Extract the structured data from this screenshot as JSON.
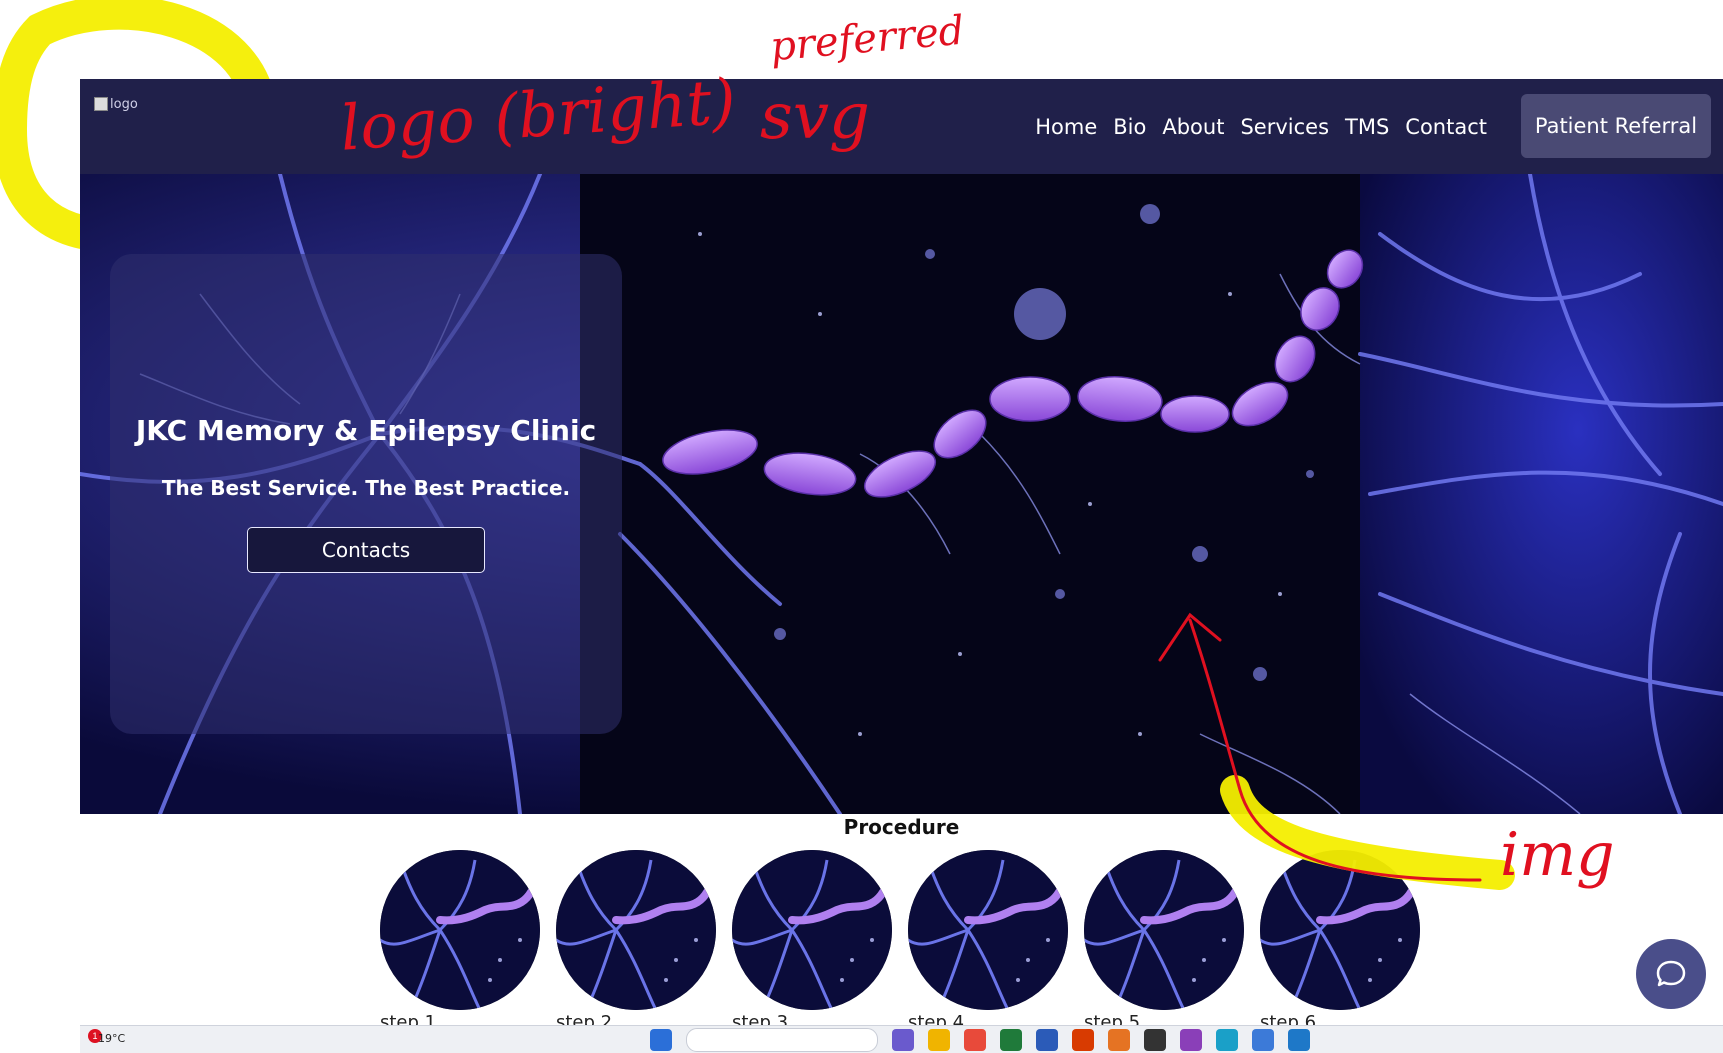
{
  "site": {
    "logo_alt": "logo",
    "nav": {
      "items": [
        {
          "label": "Home"
        },
        {
          "label": "Bio"
        },
        {
          "label": "About"
        },
        {
          "label": "Services"
        },
        {
          "label": "TMS"
        },
        {
          "label": "Contact"
        }
      ],
      "cta_label": "Patient Referral"
    },
    "hero": {
      "title": "JKC Memory & Epilepsy Clinic",
      "subtitle": "The Best Service. The Best Practice.",
      "button_label": "Contacts"
    },
    "procedure": {
      "title": "Procedure",
      "steps": [
        {
          "label": "step 1"
        },
        {
          "label": "step 2"
        },
        {
          "label": "step 3"
        },
        {
          "label": "step 4"
        },
        {
          "label": "step 5"
        },
        {
          "label": "step 6"
        }
      ]
    }
  },
  "taskbar": {
    "weather": "19°C",
    "notification_count": "1"
  },
  "annotations": {
    "logo_note": "logo (bright)",
    "svg_note": "svg",
    "preferred_note": "preferred",
    "img_note": "img"
  },
  "colors": {
    "navbar": "#20204a",
    "cta": "#4a4a74",
    "hero_bg": "#06062a",
    "neuron_blue": "#6a74e8",
    "axon_purple": "#a070e8",
    "ink_red": "#e01020",
    "highlight_yellow": "#f4ee00"
  },
  "icons": {
    "chat": "chat-bubble-icon",
    "weather": "weather-icon"
  }
}
